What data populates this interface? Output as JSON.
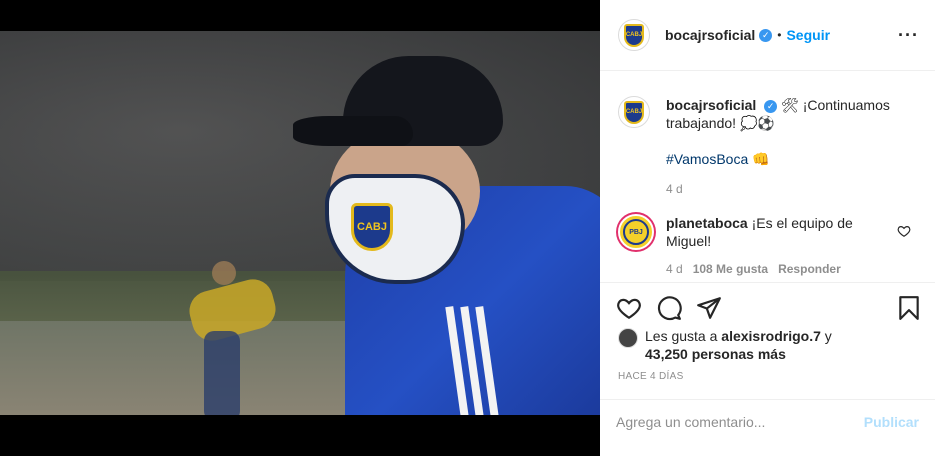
{
  "post": {
    "image_alt": ""
  },
  "header": {
    "username": "bocajrsoficial",
    "separator": "•",
    "follow_label": "Seguir",
    "more_label": "•••",
    "avatar_text": "CABJ"
  },
  "caption": {
    "username": "bocajrsoficial",
    "text": "🛠 ¡Continuamos trabajando! 💭⚽",
    "hashtag": "#VamosBoca",
    "hashtag_emoji": "👊",
    "age": "4 d"
  },
  "comments": [
    {
      "username": "planetaboca",
      "avatar_text": "PBJ",
      "text": "¡Es el equipo de Miguel!",
      "age": "4 d",
      "likes": "108 Me gusta",
      "reply_label": "Responder"
    }
  ],
  "likes": {
    "prefix": "Les gusta a",
    "user": "alexisrodrigo.7",
    "suffix": "y",
    "count": "43,250 personas más"
  },
  "timestamp": "HACE 4 DÍAS",
  "add_comment": {
    "placeholder": "Agrega un comentario...",
    "publish_label": "Publicar"
  },
  "colors": {
    "link": "#0095f6",
    "publish_disabled": "#b2dffc",
    "hashtag": "#00376b",
    "verified": "#3897f0"
  },
  "icons": [
    "heart-icon",
    "comment-icon",
    "share-icon",
    "bookmark-icon",
    "verified-icon",
    "more-icon"
  ]
}
